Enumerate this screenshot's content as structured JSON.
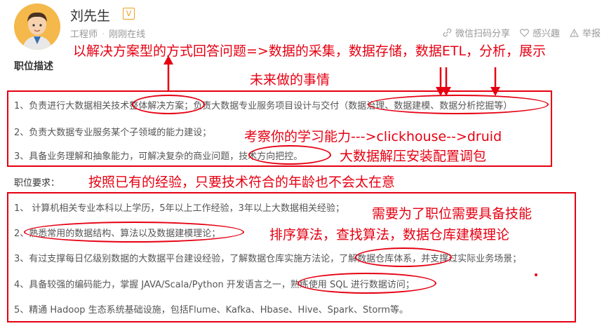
{
  "profile": {
    "name": "刘先生",
    "badge": "V",
    "title": "工程师",
    "separator": "·",
    "status": "刚刚在线",
    "actions": [
      {
        "icon": "link-icon",
        "label": "微信扫码分享"
      },
      {
        "icon": "heart-icon",
        "label": "感兴趣"
      },
      {
        "icon": "warning-icon",
        "label": "举报"
      }
    ]
  },
  "job_description": {
    "title": "职位描述",
    "items": [
      "1、负责进行大数据相关技术整体解决方案；负责大数据专业服务项目设计与交付（数据治理、数据建模、数据分析挖掘等）",
      "2、负责大数据专业服务某个子领域的能力建设；",
      "3、具备业务理解和抽象能力，可解决复杂的商业问题，技术方向把控。"
    ]
  },
  "job_requirements": {
    "title": "职位要求：",
    "items": [
      "1、 计算机相关专业本科以上学历，5年以上工作经验，3年以上大数据相关经验；",
      "2、熟悉常用的数据结构、算法以及数据建模理论；",
      "3、有过支撑每日亿级别数据的大数据平台建设经验，了解数据仓库实施方法论，了解数据仓库体系，并支撑过实际业务场景；",
      "4、具备较强的编码能力，掌握 JAVA/Scala/Python 开发语言之一，熟练使用 SQL 进行数据访问；",
      "5、精通 Hadoop 生态系统基础设施，包括Flume、Kafka、Hbase、Hive、Spark、Storm等。"
    ]
  },
  "annotations": {
    "top": "以解决方案型的方式回答问题=>数据的采集，数据存储，数据ETL，分析，展示",
    "future": "未来做的事情",
    "learning": "考察你的学习能力--->clickhouse-->druid",
    "install": "大数据解压安装配置调包",
    "experience": "按照已有的经验，只要技术符合的年龄也不会太在意",
    "skills": "需要为了职位需要具备技能",
    "algorithms": "排序算法，查找算法，数据仓库建模理论"
  },
  "colors": {
    "annotation_red": "#e60012",
    "badge_orange": "#f0a020",
    "muted_gray": "#999999"
  }
}
